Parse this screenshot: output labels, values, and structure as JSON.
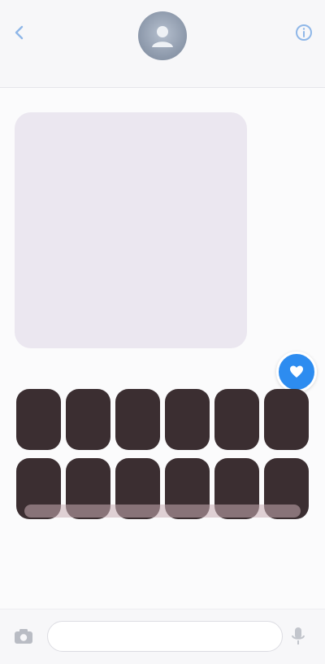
{
  "header": {
    "contact_name": "",
    "back_icon": "chevron-left-icon",
    "info_icon": "info-icon",
    "avatar_icon": "person-icon"
  },
  "thread": {
    "timestamp": "",
    "incoming_message": {
      "paragraphs": [
        "",
        ""
      ],
      "link_text": ""
    },
    "tapback_icon": "heart-icon"
  },
  "actions": [
    {
      "icon": "reply-icon",
      "glyph": "",
      "label": ""
    },
    {
      "icon": "copy-icon",
      "glyph": "",
      "label": ""
    },
    {
      "icon": "forward-icon",
      "glyph": "",
      "label": ""
    },
    {
      "icon": "star-icon",
      "glyph": "",
      "label": ""
    },
    {
      "icon": "translate-icon",
      "glyph": "",
      "label": ""
    },
    {
      "icon": "more-icon",
      "glyph": "",
      "label": ""
    },
    {
      "icon": "heart-icon",
      "glyph": "",
      "label": ""
    },
    {
      "icon": "thumbs-up-icon",
      "glyph": "",
      "label": ""
    },
    {
      "icon": "thumbs-down-icon",
      "glyph": "",
      "label": ""
    },
    {
      "icon": "haha-icon",
      "glyph": "",
      "label": ""
    },
    {
      "icon": "exclaim-icon",
      "glyph": "",
      "label": ""
    },
    {
      "icon": "question-icon",
      "glyph": "",
      "label": ""
    }
  ],
  "composer": {
    "placeholder": "",
    "value": "",
    "camera_icon": "camera-icon",
    "mic_icon": "microphone-icon"
  },
  "colors": {
    "accent": "#2d8cf0",
    "bubble_incoming": "#ebe7f0",
    "action_button": "#3b2e31",
    "link": "#2f7ee0"
  }
}
